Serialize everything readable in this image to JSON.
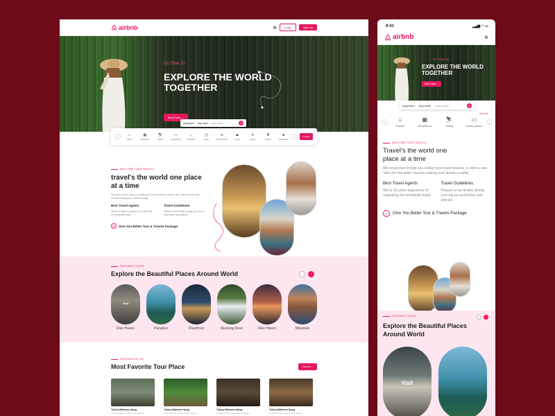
{
  "brand": "airbnb",
  "desktop": {
    "nav": {
      "login": "Login",
      "signup": "Sign Up"
    },
    "hero": {
      "tagline": "It's Time To",
      "title": "EXPLORE THE WORLD TOGETHER",
      "book_now": "Book Now"
    },
    "search": {
      "anywhere": "Anywhere",
      "any_week": "Any week",
      "add_guests": "Add guests"
    },
    "categories": [
      "Cabins",
      "Beachfront",
      "Skiing",
      "Grand pianos",
      "Mansions",
      "OMG!",
      "Amazing pools",
      "Lakes",
      "Islands",
      "Castles",
      "Countryside"
    ],
    "filters": "Filters",
    "about": {
      "eyebrow": "WELCOME TOUR TRAVELS",
      "title": "travel's the world one place at a time",
      "desc": "We would love to help you realize your travel dreams, to start a new. Take the first steps towards making your dream a reality.",
      "col1_title": "Best Travel Agents",
      "col1_text": "We've 30 years experience of organizing the worldwide travel",
      "col2_title": "Travel Guidelines",
      "col2_text": "Prepare to be flexible during your trip as restrictions and policies.",
      "package": "Give You Better Tour & Travels Package"
    },
    "featured": {
      "eyebrow": "FEATURED TOURS",
      "title": "Explore the Beautiful Places Around World",
      "visit": "Visit",
      "places": [
        "Rise Haven",
        "Paradise",
        "Riverfront",
        "Stunning River",
        "Rise Haven",
        "Mountain"
      ]
    },
    "tours": {
      "eyebrow": "DESTINATION LIST",
      "title": "Most Favorite Tour Place",
      "view_all": "View All",
      "cards": [
        {
          "name": "Turkey Balloons flying",
          "desc": "I think we have to take a lot of pictures."
        },
        {
          "name": "Turkey Balloons flying",
          "desc": "I think we have to take a lot of pictures."
        },
        {
          "name": "Turkey Balloons flying",
          "desc": "I think we have to take a lot of pictures."
        },
        {
          "name": "Turkey Balloons flying",
          "desc": "I think we have to take a lot of pictures."
        }
      ]
    }
  },
  "mobile": {
    "time": "9:41",
    "hero": {
      "tagline": "It's Time To",
      "title": "EXPLORE THE WORLD TOGETHER",
      "book_now": "Book Now"
    },
    "search": {
      "anywhere": "Anywhere",
      "any_week": "Any week",
      "add_guests": "Add guests"
    },
    "view_all": "View All",
    "categories": [
      "Cabins",
      "Beachfront",
      "Skiing",
      "Grand pianos"
    ],
    "about": {
      "eyebrow": "WELCOME TOUR TRAVELS",
      "title": "Travel's the world one place at a time",
      "desc": "We would love to help you realize your travel dreams, to start a new. Take the first steps towards making your dream a reality.",
      "col1_title": "Best Travel Agents",
      "col1_text": "We've 30 years experience of organizing the worldwide travel",
      "col2_title": "Travel Guidelines",
      "col2_text": "Prepare to be flexible during your trip as restrictions and policies.",
      "package": "Give You Better Tour & Travels Package"
    },
    "featured": {
      "eyebrow": "FEATURED TOURS",
      "title": "Explore the Beautiful Places Around World",
      "visit": "Visit"
    }
  },
  "colors": {
    "accent": "#e8175d",
    "background": "#6d0b1a",
    "pink_section": "#fde6ef"
  }
}
